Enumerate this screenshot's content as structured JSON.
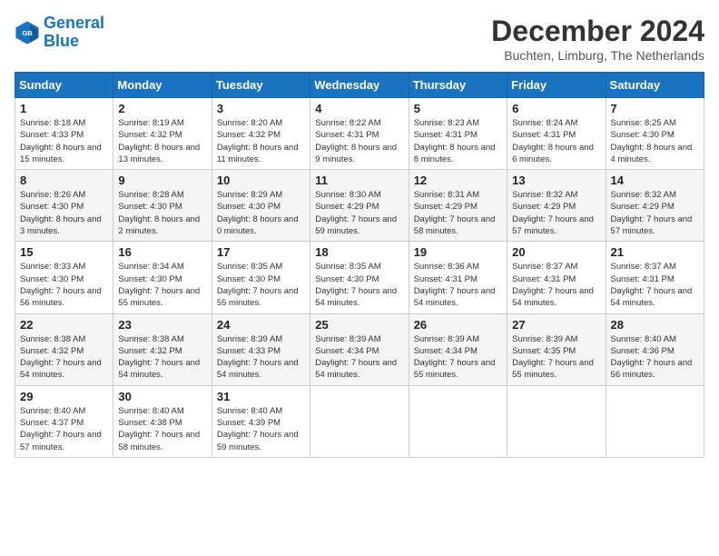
{
  "logo": {
    "line1": "General",
    "line2": "Blue"
  },
  "title": "December 2024",
  "subtitle": "Buchten, Limburg, The Netherlands",
  "weekdays": [
    "Sunday",
    "Monday",
    "Tuesday",
    "Wednesday",
    "Thursday",
    "Friday",
    "Saturday"
  ],
  "weeks": [
    [
      {
        "day": "1",
        "sunrise": "8:18 AM",
        "sunset": "4:33 PM",
        "daylight": "8 hours and 15 minutes."
      },
      {
        "day": "2",
        "sunrise": "8:19 AM",
        "sunset": "4:32 PM",
        "daylight": "8 hours and 13 minutes."
      },
      {
        "day": "3",
        "sunrise": "8:20 AM",
        "sunset": "4:32 PM",
        "daylight": "8 hours and 11 minutes."
      },
      {
        "day": "4",
        "sunrise": "8:22 AM",
        "sunset": "4:31 PM",
        "daylight": "8 hours and 9 minutes."
      },
      {
        "day": "5",
        "sunrise": "8:23 AM",
        "sunset": "4:31 PM",
        "daylight": "8 hours and 8 minutes."
      },
      {
        "day": "6",
        "sunrise": "8:24 AM",
        "sunset": "4:31 PM",
        "daylight": "8 hours and 6 minutes."
      },
      {
        "day": "7",
        "sunrise": "8:25 AM",
        "sunset": "4:30 PM",
        "daylight": "8 hours and 4 minutes."
      }
    ],
    [
      {
        "day": "8",
        "sunrise": "8:26 AM",
        "sunset": "4:30 PM",
        "daylight": "8 hours and 3 minutes."
      },
      {
        "day": "9",
        "sunrise": "8:28 AM",
        "sunset": "4:30 PM",
        "daylight": "8 hours and 2 minutes."
      },
      {
        "day": "10",
        "sunrise": "8:29 AM",
        "sunset": "4:30 PM",
        "daylight": "8 hours and 0 minutes."
      },
      {
        "day": "11",
        "sunrise": "8:30 AM",
        "sunset": "4:29 PM",
        "daylight": "7 hours and 59 minutes."
      },
      {
        "day": "12",
        "sunrise": "8:31 AM",
        "sunset": "4:29 PM",
        "daylight": "7 hours and 58 minutes."
      },
      {
        "day": "13",
        "sunrise": "8:32 AM",
        "sunset": "4:29 PM",
        "daylight": "7 hours and 57 minutes."
      },
      {
        "day": "14",
        "sunrise": "8:32 AM",
        "sunset": "4:29 PM",
        "daylight": "7 hours and 57 minutes."
      }
    ],
    [
      {
        "day": "15",
        "sunrise": "8:33 AM",
        "sunset": "4:30 PM",
        "daylight": "7 hours and 56 minutes."
      },
      {
        "day": "16",
        "sunrise": "8:34 AM",
        "sunset": "4:30 PM",
        "daylight": "7 hours and 55 minutes."
      },
      {
        "day": "17",
        "sunrise": "8:35 AM",
        "sunset": "4:30 PM",
        "daylight": "7 hours and 55 minutes."
      },
      {
        "day": "18",
        "sunrise": "8:35 AM",
        "sunset": "4:30 PM",
        "daylight": "7 hours and 54 minutes."
      },
      {
        "day": "19",
        "sunrise": "8:36 AM",
        "sunset": "4:31 PM",
        "daylight": "7 hours and 54 minutes."
      },
      {
        "day": "20",
        "sunrise": "8:37 AM",
        "sunset": "4:31 PM",
        "daylight": "7 hours and 54 minutes."
      },
      {
        "day": "21",
        "sunrise": "8:37 AM",
        "sunset": "4:31 PM",
        "daylight": "7 hours and 54 minutes."
      }
    ],
    [
      {
        "day": "22",
        "sunrise": "8:38 AM",
        "sunset": "4:32 PM",
        "daylight": "7 hours and 54 minutes."
      },
      {
        "day": "23",
        "sunrise": "8:38 AM",
        "sunset": "4:32 PM",
        "daylight": "7 hours and 54 minutes."
      },
      {
        "day": "24",
        "sunrise": "8:39 AM",
        "sunset": "4:33 PM",
        "daylight": "7 hours and 54 minutes."
      },
      {
        "day": "25",
        "sunrise": "8:39 AM",
        "sunset": "4:34 PM",
        "daylight": "7 hours and 54 minutes."
      },
      {
        "day": "26",
        "sunrise": "8:39 AM",
        "sunset": "4:34 PM",
        "daylight": "7 hours and 55 minutes."
      },
      {
        "day": "27",
        "sunrise": "8:39 AM",
        "sunset": "4:35 PM",
        "daylight": "7 hours and 55 minutes."
      },
      {
        "day": "28",
        "sunrise": "8:40 AM",
        "sunset": "4:36 PM",
        "daylight": "7 hours and 56 minutes."
      }
    ],
    [
      {
        "day": "29",
        "sunrise": "8:40 AM",
        "sunset": "4:37 PM",
        "daylight": "7 hours and 57 minutes."
      },
      {
        "day": "30",
        "sunrise": "8:40 AM",
        "sunset": "4:38 PM",
        "daylight": "7 hours and 58 minutes."
      },
      {
        "day": "31",
        "sunrise": "8:40 AM",
        "sunset": "4:39 PM",
        "daylight": "7 hours and 59 minutes."
      },
      null,
      null,
      null,
      null
    ]
  ]
}
